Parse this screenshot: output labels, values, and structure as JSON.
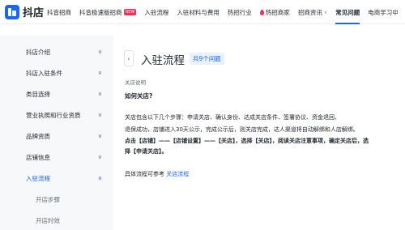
{
  "brand": {
    "name": "抖店"
  },
  "nav": {
    "items": [
      {
        "label": "抖音招商"
      },
      {
        "label": "抖音极速版招商",
        "badge": "NEW"
      },
      {
        "label": "入驻流程"
      },
      {
        "label": "入驻材料与费用"
      },
      {
        "label": "热招行业"
      },
      {
        "label": "热招商家",
        "hot": true
      },
      {
        "label": "招商资讯",
        "caret": "∨"
      },
      {
        "label": "常见问题",
        "active": true
      },
      {
        "label": "电商学习中"
      }
    ]
  },
  "sidebar": {
    "items": [
      {
        "label": "抖店介绍",
        "chevron": "∨"
      },
      {
        "label": "抖店入驻条件",
        "chevron": "∨"
      },
      {
        "label": "类目选择",
        "chevron": "∨"
      },
      {
        "label": "营业执照和行业资质",
        "chevron": "∨"
      },
      {
        "label": "品牌资质",
        "chevron": "∨"
      },
      {
        "label": "店铺信息",
        "chevron": "∨"
      },
      {
        "label": "入驻流程",
        "chevron": "∧",
        "expanded": true
      },
      {
        "label": "开店步骤",
        "sub": true
      },
      {
        "label": "开店时效",
        "sub": true
      }
    ]
  },
  "main": {
    "back_icon": "‹",
    "title": "入驻流程",
    "count_badge": "共9个问题",
    "section_label": "关店说明",
    "question": "如何关店?",
    "paragraphs": [
      "关店包含以下几个步骤：申请关店、确认身份、达成关店条件、签署协议、资金退回、",
      "退保成功，店铺进入30天公示，完成公示后，则关店完成，达人渠道将自动解绑和人店解绑。",
      "点击【店铺】——【店铺设置】——【关店】，选择【关店】，阅读关店注意事项，确定关店后，选",
      "择【申请关店】。"
    ],
    "reference_prefix": "具体流程可参考 ",
    "reference_link": "关店流程"
  },
  "colors": {
    "accent": "#1966ff",
    "hot": "#fe2c55",
    "sidebar_bg": "#f7f8fa"
  }
}
